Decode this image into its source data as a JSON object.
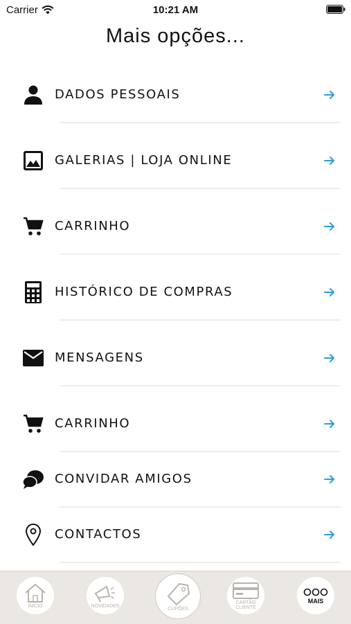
{
  "status_bar": {
    "carrier": "Carrier",
    "time": "10:21 AM"
  },
  "page": {
    "title": "Mais opções..."
  },
  "colors": {
    "accent_arrow": "#2b9cd8",
    "tab_bar_bg": "#ebe7e2"
  },
  "menu": {
    "items": [
      {
        "label": "DADOS PESSOAIS",
        "icon": "person-icon"
      },
      {
        "label": "GALERIAS | LOJA ONLINE",
        "icon": "image-icon"
      },
      {
        "label": "CARRINHO",
        "icon": "cart-icon"
      },
      {
        "label": "HISTÓRICO DE COMPRAS",
        "icon": "calculator-icon"
      },
      {
        "label": "MENSAGENS",
        "icon": "mail-icon"
      },
      {
        "label": "CARRINHO",
        "icon": "cart-icon"
      },
      {
        "label": "CONVIDAR AMIGOS",
        "icon": "chat-bubbles-icon"
      },
      {
        "label": "CONTACTOS",
        "icon": "location-pin-icon"
      }
    ]
  },
  "tabs": [
    {
      "label": "INÍCIO",
      "icon": "home-icon"
    },
    {
      "label": "NOVIDADES",
      "icon": "megaphone-icon"
    },
    {
      "label": "CUPÕES",
      "icon": "tag-icon"
    },
    {
      "label": "CARTÃO CLIENTE",
      "icon": "card-icon"
    },
    {
      "label": "MAIS",
      "icon": "more-icon"
    }
  ]
}
